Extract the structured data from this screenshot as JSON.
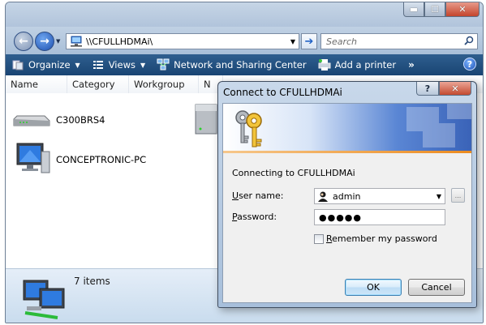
{
  "explorer": {
    "address": "\\\\CFULLHDMAi\\",
    "search_placeholder": "Search",
    "toolbar": {
      "organize": "Organize",
      "views": "Views",
      "network_sharing": "Network and Sharing Center",
      "add_printer": "Add a printer",
      "more": "»"
    },
    "columns": [
      "Name",
      "Category",
      "Workgroup",
      "N"
    ],
    "items": [
      {
        "label": "C300BRS4",
        "icon": "router-icon"
      },
      {
        "label": "CONCEPTRONIC-PC",
        "icon": "computer-icon"
      }
    ],
    "status": "7 items",
    "window_buttons": {
      "minimize": "▬",
      "maximize": "☐",
      "close": "✕"
    },
    "help": "?"
  },
  "dialog": {
    "title": "Connect to CFULLHDMAi",
    "help_glyph": "?",
    "close_glyph": "✕",
    "connecting_text": "Connecting to CFULLHDMAi",
    "username_label_u": "U",
    "username_label_rest": "ser name:",
    "username_value": "admin",
    "password_label_u": "P",
    "password_label_rest": "assword:",
    "password_value": "●●●●●",
    "remember_label_u": "R",
    "remember_label_rest": "emember my password",
    "remember_checked": false,
    "ok_label": "OK",
    "cancel_label": "Cancel",
    "browse_label": "..."
  }
}
